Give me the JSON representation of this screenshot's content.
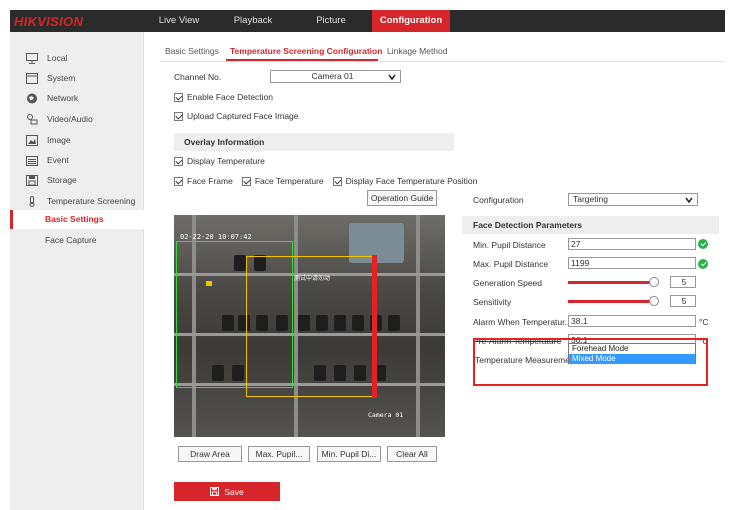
{
  "brand": "HIKVISION",
  "topnav": [
    "Live View",
    "Playback",
    "Picture",
    "Configuration"
  ],
  "sidebar": {
    "items": [
      "Local",
      "System",
      "Network",
      "Video/Audio",
      "Image",
      "Event",
      "Storage",
      "Temperature Screening"
    ],
    "subitems": [
      "Basic Settings",
      "Face Capture"
    ],
    "active_subitem": "Basic Settings"
  },
  "tabs": [
    "Basic Settings",
    "Temperature Screening Configuration",
    "Linkage Method"
  ],
  "active_tab": "Temperature Screening Configuration",
  "channel": {
    "label": "Channel No.",
    "value": "Camera 01"
  },
  "enable_face_detection": {
    "label": "Enable Face Detection",
    "checked": true
  },
  "upload_face_image": {
    "label": "Upload Captured Face Image",
    "checked": true
  },
  "overlay": {
    "title": "Overlay Information",
    "display_temperature": {
      "label": "Display Temperature",
      "checked": true
    },
    "face_frame": {
      "label": "Face Frame",
      "checked": true
    },
    "face_temperature": {
      "label": "Face Temperature",
      "checked": true
    },
    "display_position": {
      "label": "Display Face Temperature Position",
      "checked": true
    }
  },
  "operation_guide": "Operation Guide",
  "video": {
    "timestamp": "02-22-20   10:07:42",
    "camera_label": "Camera 01",
    "sign_text": "测试中请勿动"
  },
  "video_buttons": [
    "Draw Area",
    "Max. Pupil...",
    "Min. Pupil Di...",
    "Clear All"
  ],
  "save": "Save",
  "configuration": {
    "label": "Configuration",
    "value": "Targeting"
  },
  "params": {
    "title": "Face Detection Parameters",
    "min_pupil": {
      "label": "Min. Pupil Distance",
      "value": "27"
    },
    "max_pupil": {
      "label": "Max. Pupil Distance",
      "value": "1199"
    },
    "generation_speed": {
      "label": "Generation Speed",
      "value": "5",
      "level": 0.9
    },
    "sensitivity": {
      "label": "Sensitivity",
      "value": "5",
      "level": 0.9
    },
    "alarm_temp": {
      "label": "Alarm When Temperatur...",
      "value": "38.1",
      "unit": "°C"
    },
    "pre_alarm_temp": {
      "label": "Pre-Alarm Temperature",
      "value": "36.1",
      "unit": "°C"
    },
    "measurement_mode": {
      "label": "Temperature Measureme...",
      "options": [
        "Forehead Mode",
        "Mixed Mode"
      ],
      "selected": "Mixed Mode"
    }
  },
  "colors": {
    "accent": "#d6262b",
    "topbar": "#2b2b2b",
    "sidebar": "#eeeeee",
    "ok": "#2bb24c",
    "selection": "#3399ff",
    "highlight": "#e52222"
  }
}
